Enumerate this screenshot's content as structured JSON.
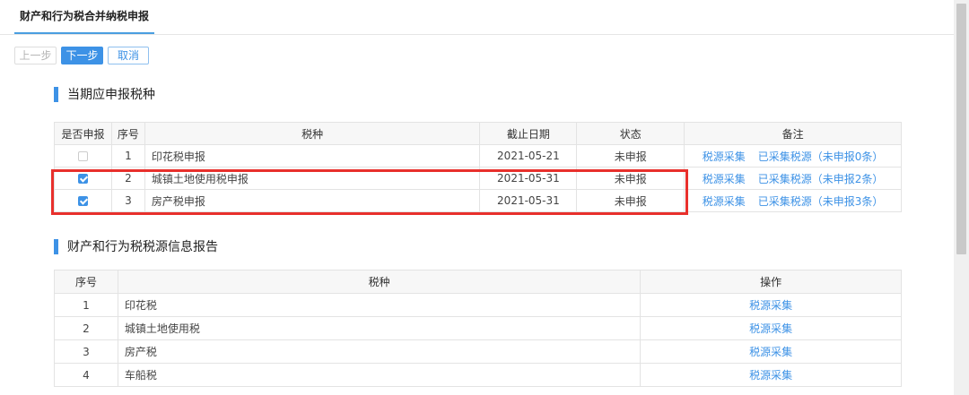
{
  "tab": {
    "title": "财产和行为税合并纳税申报"
  },
  "toolbar": {
    "prev_label": "上一步",
    "next_label": "下一步",
    "cancel_label": "取消"
  },
  "section1": {
    "title": "当期应申报税种",
    "headers": [
      "是否申报",
      "序号",
      "税种",
      "截止日期",
      "状态",
      "备注"
    ],
    "rows": [
      {
        "checked": false,
        "index": "1",
        "tax": "印花税申报",
        "deadline": "2021-05-21",
        "status": "未申报",
        "link1": "税源采集",
        "link2": "已采集税源（未申报0条）"
      },
      {
        "checked": true,
        "index": "2",
        "tax": "城镇土地使用税申报",
        "deadline": "2021-05-31",
        "status": "未申报",
        "link1": "税源采集",
        "link2": "已采集税源（未申报2条）"
      },
      {
        "checked": true,
        "index": "3",
        "tax": "房产税申报",
        "deadline": "2021-05-31",
        "status": "未申报",
        "link1": "税源采集",
        "link2": "已采集税源（未申报3条）"
      }
    ]
  },
  "section2": {
    "title": "财产和行为税税源信息报告",
    "headers": [
      "序号",
      "税种",
      "操作"
    ],
    "rows": [
      {
        "index": "1",
        "tax": "印花税",
        "action": "税源采集"
      },
      {
        "index": "2",
        "tax": "城镇土地使用税",
        "action": "税源采集"
      },
      {
        "index": "3",
        "tax": "房产税",
        "action": "税源采集"
      },
      {
        "index": "4",
        "tax": "车船税",
        "action": "税源采集"
      }
    ]
  },
  "colors": {
    "accent": "#3d92e6",
    "highlight": "#e8302c"
  }
}
